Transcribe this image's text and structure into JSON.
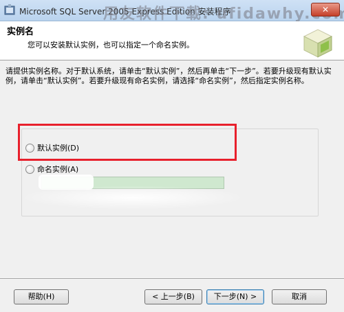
{
  "window": {
    "title": "Microsoft SQL Server 2005 Express Edition 安装程序",
    "watermark": "用友软件下载: ufidawhy.com"
  },
  "header": {
    "title": "实例名",
    "subtitle": "您可以安装默认实例，也可以指定一个命名实例。"
  },
  "description": "请提供实例名称。对于默认系统，请单击“默认实例”，然后再单击“下一步”。若要升级现有默认实例，请单击“默认实例”。若要升级现有命名实例，请选择“命名实例”，然后指定实例名称。",
  "options": {
    "default_instance_label": "默认实例(D)",
    "named_instance_label": "命名实例(A)",
    "named_instance_value": "",
    "selected": "default_instance"
  },
  "buttons": {
    "help": "帮助(H)",
    "back": "< 上一步(B)",
    "next": "下一步(N) >",
    "cancel": "取消"
  }
}
